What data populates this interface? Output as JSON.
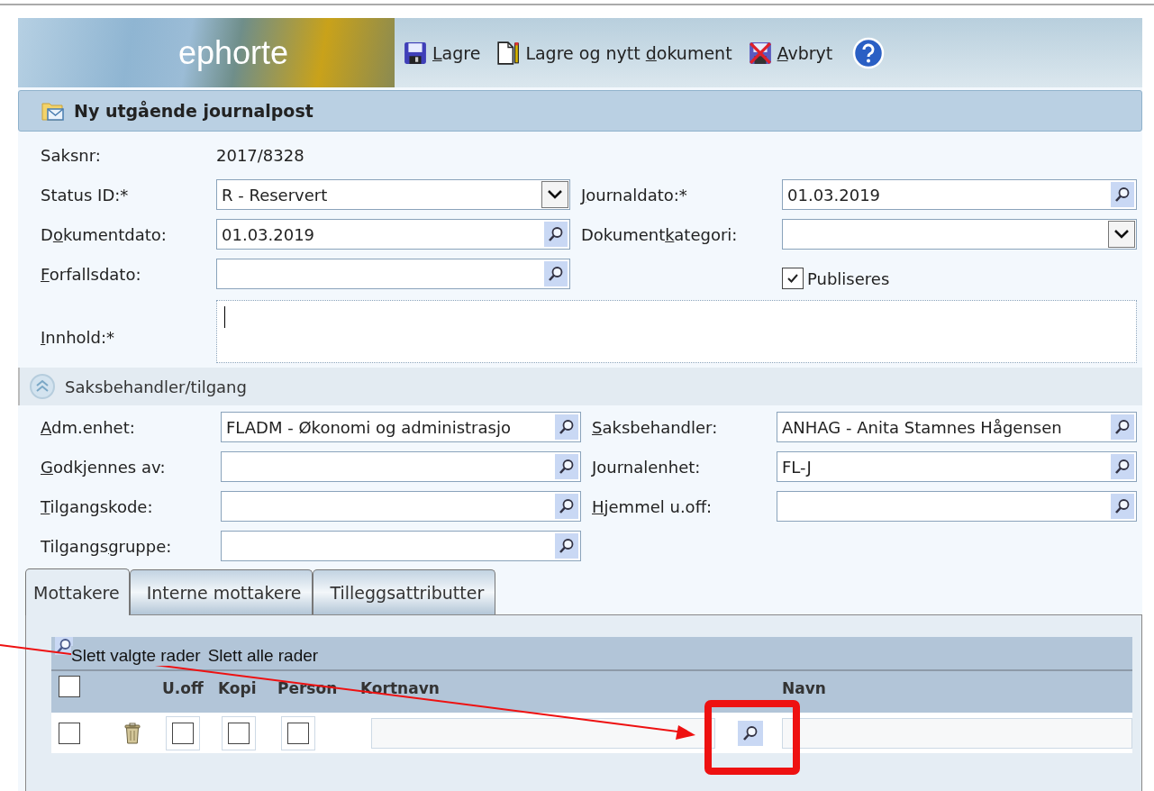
{
  "header": {
    "logo": "ephorte",
    "actions": [
      {
        "kind": "save",
        "label": {
          "key": "L",
          "post": "agre"
        }
      },
      {
        "kind": "save_new",
        "label": {
          "pre": "Lagre og nytt ",
          "key": "d",
          "post": "okument"
        }
      },
      {
        "kind": "cancel",
        "label": {
          "key": "A",
          "post": "vbryt"
        }
      },
      {
        "kind": "help"
      }
    ]
  },
  "form_title": "Ny utgående journalpost",
  "main_form": [
    {
      "cells": [
        {
          "kind": "static",
          "label": {
            "pre": "Saksnr:"
          },
          "value": "2017/8328"
        }
      ]
    },
    {
      "cells": [
        {
          "kind": "select",
          "label": {
            "pre": "Status ID:*"
          },
          "value": "R - Reservert"
        },
        {
          "kind": "lookup",
          "label": {
            "key": "J",
            "post": "ournaldato:*"
          },
          "value": "01.03.2019"
        }
      ]
    },
    {
      "cells": [
        {
          "kind": "lookup",
          "label": {
            "pre": "D",
            "key": "o",
            "post": "kumentdato:"
          },
          "value": "01.03.2019"
        },
        {
          "kind": "select",
          "label": {
            "pre": "Dokument",
            "key": "k",
            "post": "ategori:"
          }
        }
      ]
    },
    {
      "cells": [
        {
          "kind": "lookup",
          "label": {
            "key": "F",
            "post": "orfallsdato:"
          }
        },
        {
          "kind": "checkbox",
          "text": "Publiseres",
          "checked": true
        }
      ]
    },
    {
      "cells": [
        {
          "kind": "textarea",
          "label": {
            "key": "I",
            "post": "nnhold:*"
          }
        }
      ]
    }
  ],
  "section": {
    "title": "Saksbehandler/tilgang",
    "expanded": true,
    "rows": [
      {
        "cells": [
          {
            "kind": "lookup",
            "label": {
              "key": "A",
              "post": "dm.enhet:"
            },
            "value": "FLADM - Økonomi og administrasjo"
          },
          {
            "kind": "lookup",
            "label": {
              "key": "S",
              "post": "aksbehandler:"
            },
            "value": "ANHAG - Anita Stamnes Hågensen"
          }
        ]
      },
      {
        "cells": [
          {
            "kind": "lookup",
            "label": {
              "key": "G",
              "post": "odkjennes av:"
            }
          },
          {
            "kind": "lookup",
            "label": {
              "pre": "Journalenhet:"
            },
            "value": "FL-J"
          }
        ]
      },
      {
        "cells": [
          {
            "kind": "lookup",
            "label": {
              "key": "T",
              "post": "ilgangskode:"
            }
          },
          {
            "kind": "lookup",
            "label": {
              "key": "H",
              "post": "jemmel u.off:"
            }
          }
        ]
      },
      {
        "cells": [
          {
            "kind": "lookup",
            "label": {
              "pre": "Tilgangs",
              "key": "g",
              "post": "ruppe:"
            }
          }
        ]
      }
    ]
  },
  "tabs": [
    {
      "label": "Mottakere",
      "selected": true
    },
    {
      "label": "Interne mottakere",
      "selected": false
    },
    {
      "label": "Tilleggsattributter",
      "selected": false
    }
  ],
  "recipients": {
    "actions": [
      "Slett valgte rader",
      "Slett alle rader"
    ],
    "select_all_checked": false,
    "columns": [
      "U.off",
      "Kopi",
      "Person",
      "Kortnavn",
      "Navn"
    ],
    "rows": [
      {
        "selected": false,
        "u_off": false,
        "kopi": false,
        "person": false
      }
    ]
  }
}
